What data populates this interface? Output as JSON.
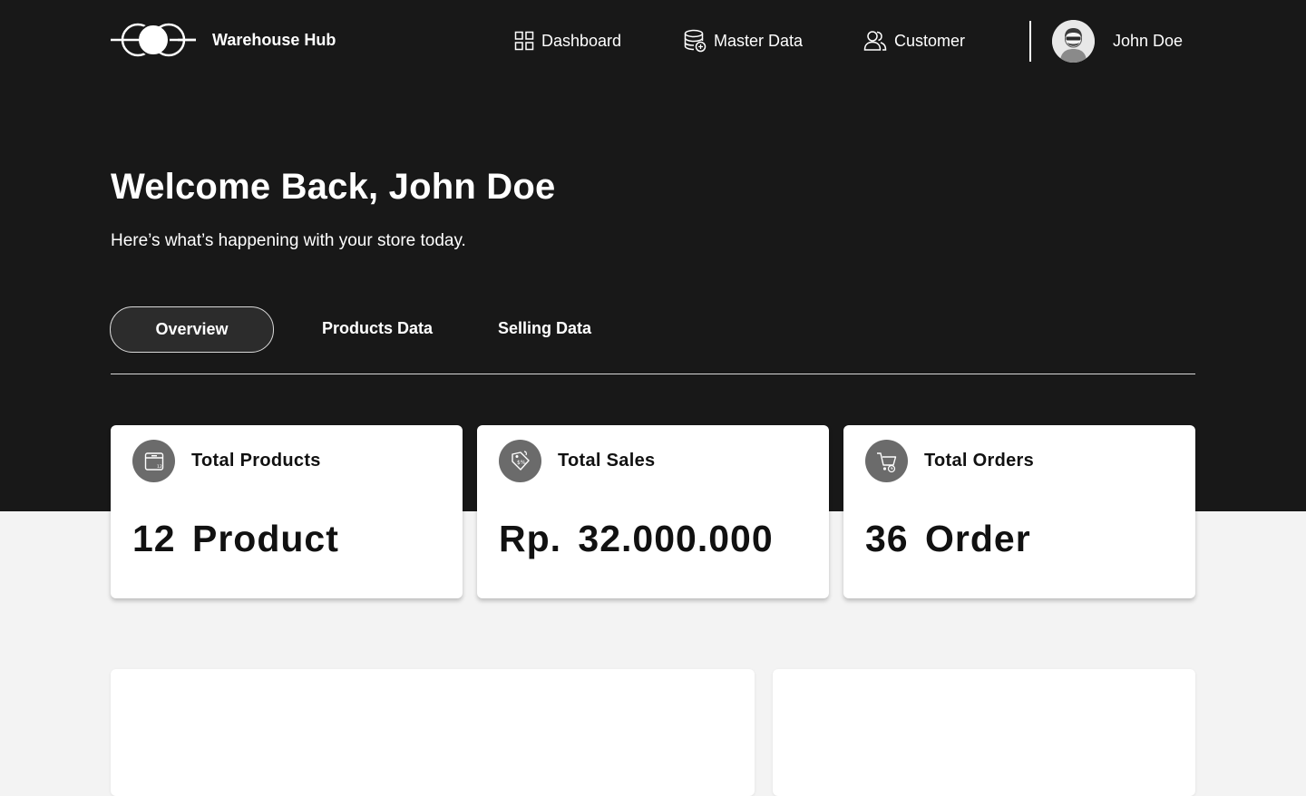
{
  "brand": {
    "name": "Warehouse Hub",
    "logo_icon": "linked-circles-logo"
  },
  "nav": {
    "items": [
      {
        "label": "Dashboard",
        "icon": "grid-icon"
      },
      {
        "label": "Master Data",
        "icon": "database-icon"
      },
      {
        "label": "Customer",
        "icon": "users-icon"
      }
    ]
  },
  "user": {
    "name": "John Doe",
    "avatar_icon": "avatar-icon"
  },
  "greeting": {
    "title": "Welcome Back, John Doe",
    "subtitle": "Here’s what’s happening with your store today."
  },
  "tabs": [
    {
      "label": "Overview",
      "active": true
    },
    {
      "label": "Products Data",
      "active": false
    },
    {
      "label": "Selling Data",
      "active": false
    }
  ],
  "stats": [
    {
      "title": "Total Products",
      "value": "12 Product",
      "icon": "box-icon"
    },
    {
      "title": "Total Sales",
      "value": "Rp. 32.000.000",
      "icon": "price-tag-icon"
    },
    {
      "title": "Total Orders",
      "value": "36 Order",
      "icon": "cart-icon"
    }
  ],
  "colors": {
    "header_bg": "#181818",
    "page_bg": "#f3f3f3",
    "card_bg": "#ffffff",
    "icon_circle": "#6b6b6b"
  }
}
